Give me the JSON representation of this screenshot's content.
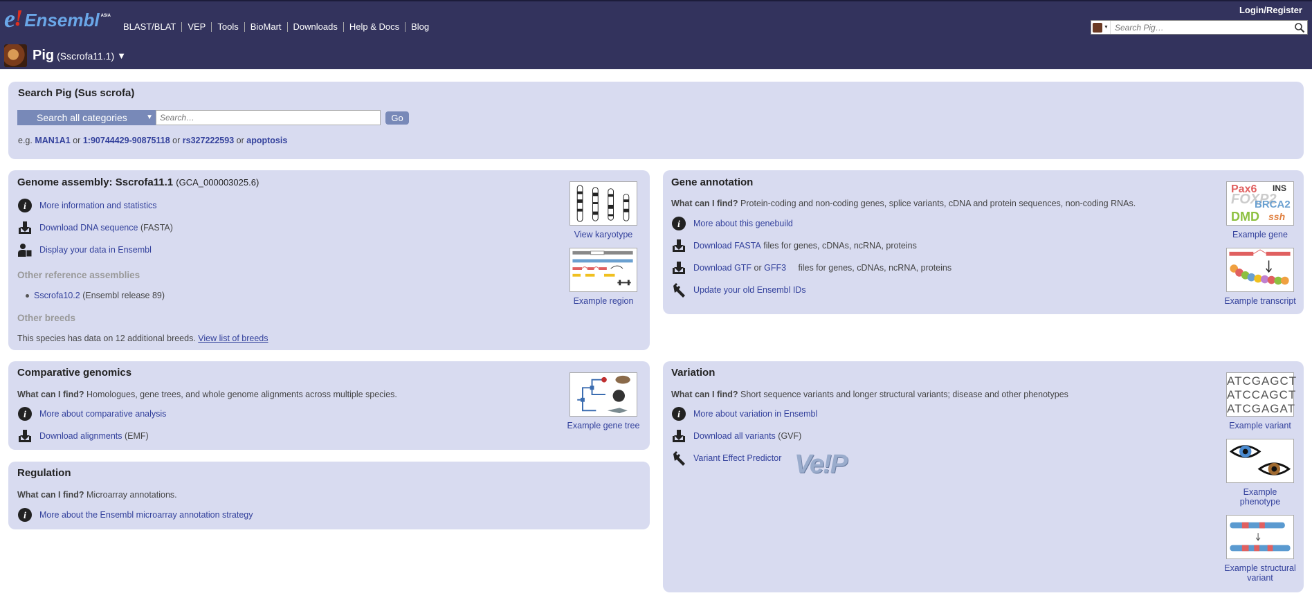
{
  "header": {
    "logo_text": "Ensembl",
    "logo_suffix": "ASIA",
    "nav": [
      "BLAST/BLAT",
      "VEP",
      "Tools",
      "BioMart",
      "Downloads",
      "Help & Docs",
      "Blog"
    ],
    "login": "Login/Register",
    "search_placeholder": "Search Pig…",
    "species_name": "Pig",
    "species_assembly": "(Sscrofa11.1)",
    "species_dropdown": "▼"
  },
  "search": {
    "title": "Search Pig (Sus scrofa)",
    "category": "Search all categories",
    "placeholder": "Search…",
    "go": "Go",
    "eg": "e.g.",
    "or": "or",
    "examples": [
      "MAN1A1",
      "1:90744429-90875118",
      "rs327222593",
      "apoptosis"
    ]
  },
  "genome": {
    "title": "Genome assembly: Sscrofa11.1",
    "accession": "(GCA_000003025.6)",
    "links": [
      "More information and statistics",
      "Download DNA sequence",
      "Display your data in Ensembl"
    ],
    "fasta_note": "(FASTA)",
    "other_ref_heading": "Other reference assemblies",
    "other_ref_link": "Sscrofa10.2",
    "other_ref_note": "(Ensembl release 89)",
    "breeds_heading": "Other breeds",
    "breeds_text": "This species has data on 12 additional breeds.",
    "breeds_link": "View list of breeds",
    "thumb_karyotype": "View karyotype",
    "thumb_region": "Example region"
  },
  "gene": {
    "title": "Gene annotation",
    "whatcan_label": "What can I find?",
    "whatcan_text": "Protein-coding and non-coding genes, splice variants, cDNA and protein sequences, non-coding RNAs.",
    "link_genebuild": "More about this genebuild",
    "link_fasta": "Download FASTA",
    "fasta_tail": "files for genes, cDNAs, ncRNA, proteins",
    "link_gtf": "Download GTF",
    "gtf_or": "or",
    "link_gff3": "GFF3",
    "gff_tail": "files for genes, cDNAs, ncRNA, proteins",
    "link_update": "Update your old Ensembl IDs",
    "thumb_gene": "Example gene",
    "thumb_transcript": "Example transcript",
    "gene_words": [
      "Pax6",
      "INS",
      "FOXP2",
      "BRCA2",
      "DMD",
      "ssh"
    ]
  },
  "compara": {
    "title": "Comparative genomics",
    "whatcan_label": "What can I find?",
    "whatcan_text": "Homologues, gene trees, and whole genome alignments across multiple species.",
    "link_more": "More about comparative analysis",
    "link_download": "Download alignments",
    "download_note": "(EMF)",
    "thumb_tree": "Example gene tree"
  },
  "regulation": {
    "title": "Regulation",
    "whatcan_label": "What can I find?",
    "whatcan_text": "Microarray annotations.",
    "link_more": "More about the Ensembl microarray annotation strategy"
  },
  "variation": {
    "title": "Variation",
    "whatcan_label": "What can I find?",
    "whatcan_text": "Short sequence variants and longer structural variants; disease and other phenotypes",
    "link_more": "More about variation in Ensembl",
    "link_download": "Download all variants",
    "download_note": "(GVF)",
    "link_vep": "Variant Effect Predictor",
    "vep_logo": "Ve!P",
    "thumb_variant": "Example variant",
    "thumb_phenotype": "Example phenotype",
    "thumb_sv": "Example structural variant",
    "seq_lines": [
      "ATCGAGCT",
      "ATCCAGCT",
      "ATCGAGAT"
    ]
  },
  "colors": {
    "masthead": "#33335d",
    "panel": "#d8dbf0",
    "link": "#33419c",
    "button": "#7889b8"
  }
}
